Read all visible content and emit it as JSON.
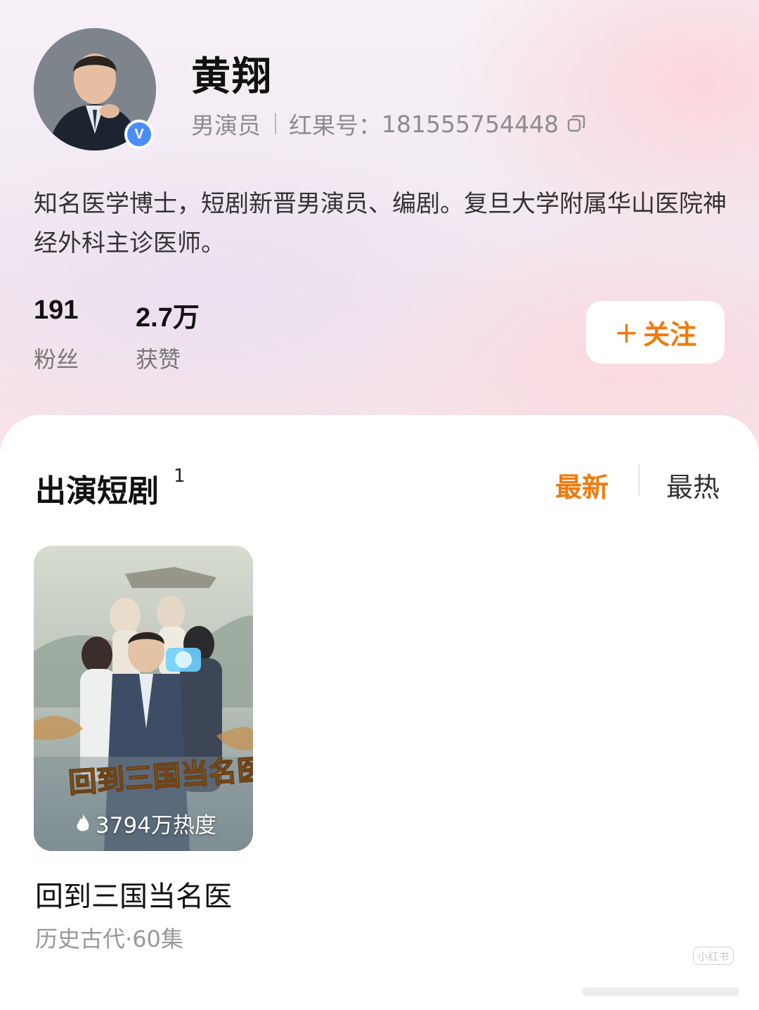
{
  "profile": {
    "name": "黄翔",
    "role": "男演员",
    "id_label": "红果号：",
    "id_value": "181555754448",
    "verified_mark": "V",
    "bio": "知名医学博士，短剧新晋男演员、编剧。复旦大学附属华山医院神经外科主诊医师。"
  },
  "stats": {
    "fans_value": "191",
    "fans_label": "粉丝",
    "likes_value": "2.7万",
    "likes_label": "获赞"
  },
  "follow_button": {
    "plus": "+",
    "label": "关注"
  },
  "section": {
    "title": "出演短剧",
    "count": "1",
    "sort_newest": "最新",
    "sort_hottest": "最热"
  },
  "dramas": [
    {
      "title": "回到三国当名医",
      "poster_title": "回到三国当名医",
      "heat": "3794万热度",
      "genre": "历史古代",
      "dot": "·",
      "episodes": "60集"
    }
  ],
  "watermark": {
    "text": "小红书"
  },
  "colors": {
    "accent": "#f07a10",
    "verified": "#4b8df8",
    "secondary_text": "#8c8c90"
  },
  "icons": {
    "verified": "verified-badge-icon",
    "copy": "copy-icon",
    "heat": "flame-icon"
  }
}
